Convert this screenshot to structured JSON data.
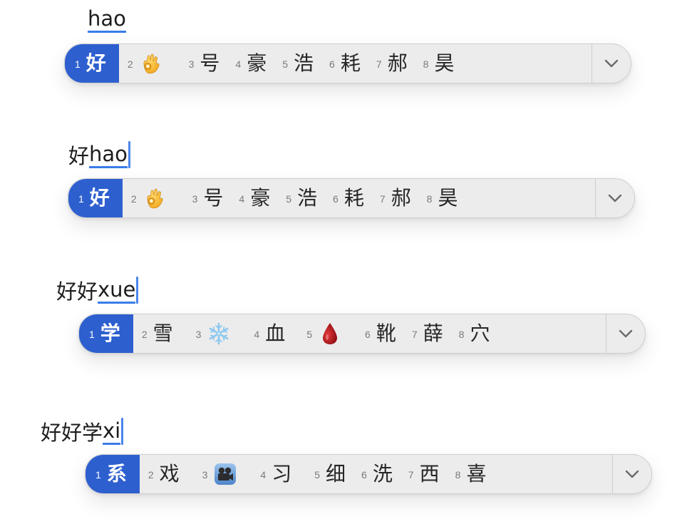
{
  "rows": [
    {
      "committed": "",
      "pinyin": "hao",
      "candidates": [
        {
          "num": "1",
          "text": "好"
        },
        {
          "num": "2",
          "icon": "ok-hand-icon"
        },
        {
          "num": "3",
          "text": "号"
        },
        {
          "num": "4",
          "text": "豪"
        },
        {
          "num": "5",
          "text": "浩"
        },
        {
          "num": "6",
          "text": "耗"
        },
        {
          "num": "7",
          "text": "郝"
        },
        {
          "num": "8",
          "text": "昊"
        }
      ]
    },
    {
      "committed": "好",
      "pinyin": "hao",
      "candidates": [
        {
          "num": "1",
          "text": "好"
        },
        {
          "num": "2",
          "icon": "ok-hand-icon"
        },
        {
          "num": "3",
          "text": "号"
        },
        {
          "num": "4",
          "text": "豪"
        },
        {
          "num": "5",
          "text": "浩"
        },
        {
          "num": "6",
          "text": "耗"
        },
        {
          "num": "7",
          "text": "郝"
        },
        {
          "num": "8",
          "text": "昊"
        }
      ]
    },
    {
      "committed": "好好",
      "pinyin": "xue",
      "candidates": [
        {
          "num": "1",
          "text": "学"
        },
        {
          "num": "2",
          "text": "雪"
        },
        {
          "num": "3",
          "icon": "snowflake-icon"
        },
        {
          "num": "4",
          "text": "血"
        },
        {
          "num": "5",
          "icon": "blood-drop-icon"
        },
        {
          "num": "6",
          "text": "靴"
        },
        {
          "num": "7",
          "text": "薛"
        },
        {
          "num": "8",
          "text": "穴"
        }
      ]
    },
    {
      "committed": "好好学",
      "pinyin": "xi",
      "candidates": [
        {
          "num": "1",
          "text": "系"
        },
        {
          "num": "2",
          "text": "戏"
        },
        {
          "num": "3",
          "icon": "movie-camera-icon"
        },
        {
          "num": "4",
          "text": "习"
        },
        {
          "num": "5",
          "text": "细"
        },
        {
          "num": "6",
          "text": "洗"
        },
        {
          "num": "7",
          "text": "西"
        },
        {
          "num": "8",
          "text": "喜"
        }
      ]
    }
  ],
  "expand_icon": "chevron-down-icon",
  "colors": {
    "selected_bg": "#2d5fcf",
    "panel_bg": "#ececec",
    "underline": "#3a7ce8"
  }
}
